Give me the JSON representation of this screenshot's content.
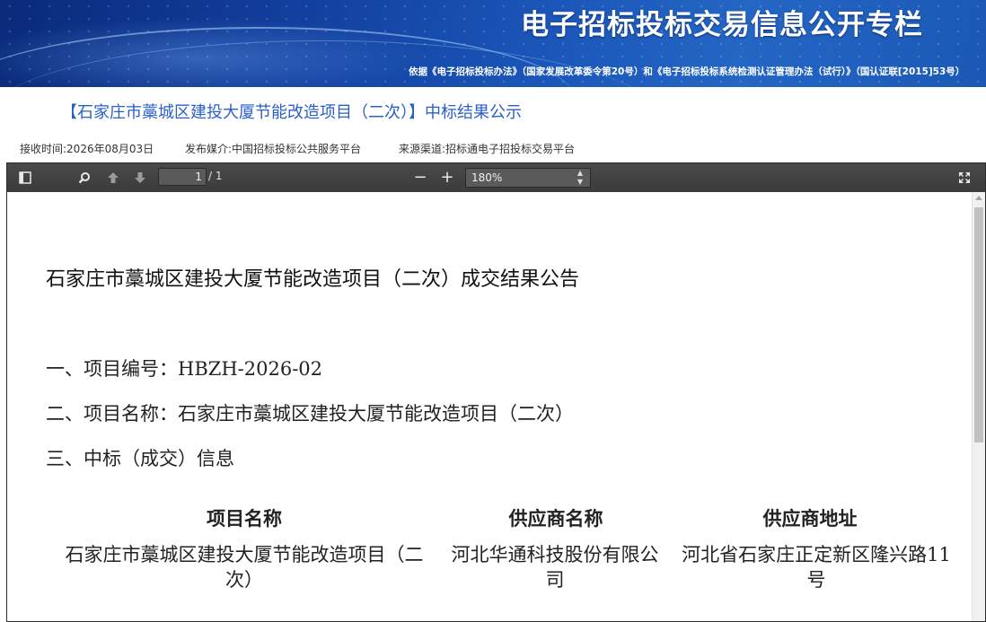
{
  "banner": {
    "title": "电子招标投标交易信息公开专栏",
    "subtitle": "依据《电子招标投标办法》（国家发展改革委令第20号）和《电子招标投标系统检测认证管理办法（试行）》（国认证联[2015]53号）"
  },
  "notice": {
    "title": "【石家庄市藁城区建投大厦节能改造项目（二次）】中标结果公示",
    "received": "接收时间:2026年08月03日",
    "media": "发布媒介:中国招标投标公共服务平台",
    "source": "来源渠道:招标通电子招投标交易平台"
  },
  "viewer": {
    "page_current": "1",
    "page_total": "/ 1",
    "zoom": "180%",
    "icons": [
      "sidebar-toggle-icon",
      "search-icon",
      "previous-page-icon",
      "next-page-icon",
      "zoom-out-icon",
      "zoom-in-icon",
      "fullscreen-icon"
    ],
    "zoom_minus": "−",
    "zoom_plus": "+"
  },
  "document": {
    "heading": "石家庄市藁城区建投大厦节能改造项目（二次）成交结果公告",
    "item1": "一、项目编号：HBZH-2026-02",
    "item2": "二、项目名称：石家庄市藁城区建投大厦节能改造项目（二次）",
    "item3": "三、中标（成交）信息",
    "table": {
      "headers": [
        "项目名称",
        "供应商名称",
        "供应商地址"
      ],
      "row": [
        "石家庄市藁城区建投大厦节能改造项目（二次）",
        "河北华通科技股份有限公司",
        "河北省石家庄正定新区隆兴路11号"
      ]
    }
  }
}
